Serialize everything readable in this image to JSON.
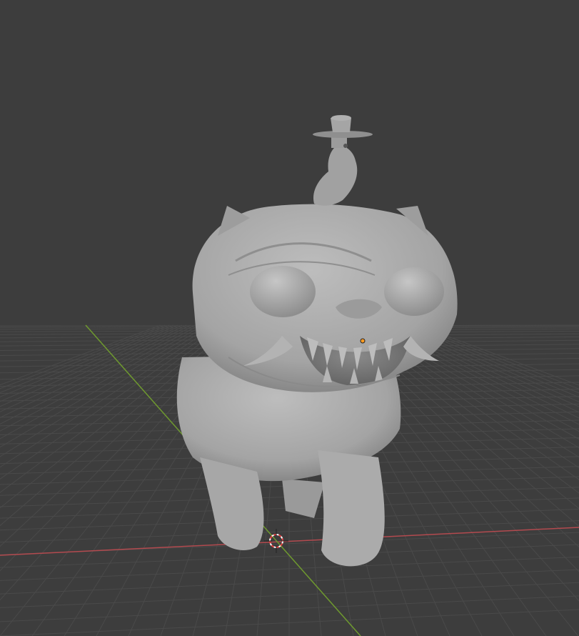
{
  "viewport": {
    "background_color": "#3d3d3d",
    "grid_color": "#4a4a4a",
    "x_axis_color": "#b34a4f",
    "y_axis_color": "#6f9a2f",
    "model_color": "#a9a9a9",
    "model_shadow_color": "#7e7e7e",
    "cursor_colors": [
      "#e04040",
      "#ffffff"
    ],
    "origin_marker_color": "#ff9b20"
  },
  "scene": {
    "object_description_icon": "sculpted-cat-monster-mesh",
    "cursor_icon": "3d-cursor-icon",
    "origin_icon": "object-origin-icon"
  }
}
